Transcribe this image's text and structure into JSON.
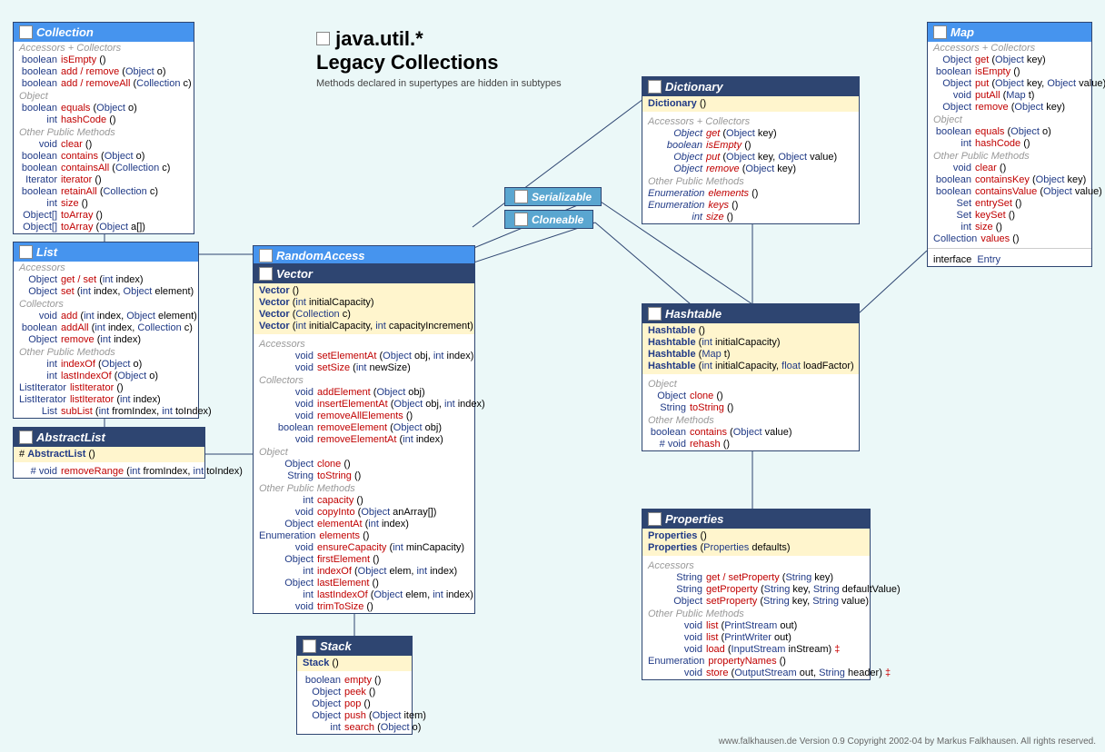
{
  "title1": "java.util.*",
  "title2": "Legacy Collections",
  "subtitle": "Methods declared in supertypes are hidden in subtypes",
  "footer": "www.falkhausen.de Version 0.9 Copyright 2002-04 by Markus Falkhausen. All rights reserved.",
  "ser": "Serializable",
  "clo": "Cloneable",
  "ra": "RandomAccess",
  "collection": {
    "title": "Collection",
    "secs": [
      {
        "h": "Accessors + Collectors",
        "rows": [
          {
            "ret": "boolean",
            "name": "isEmpty",
            "args": "()"
          },
          {
            "ret": "boolean",
            "name": "add / remove",
            "args": "(<t>Object</t> o)"
          },
          {
            "ret": "boolean",
            "name": "add / removeAll",
            "args": "(<t>Collection</t> c)"
          }
        ]
      },
      {
        "h": "Object",
        "rows": [
          {
            "ret": "boolean",
            "name": "equals",
            "args": "(<t>Object</t> o)"
          },
          {
            "ret": "int",
            "name": "hashCode",
            "args": "()"
          }
        ]
      },
      {
        "h": "Other Public Methods",
        "rows": [
          {
            "ret": "void",
            "name": "clear",
            "args": "()"
          },
          {
            "ret": "boolean",
            "name": "contains",
            "args": "(<t>Object</t> o)"
          },
          {
            "ret": "boolean",
            "name": "containsAll",
            "args": "(<t>Collection</t> c)"
          },
          {
            "ret": "Iterator",
            "name": "iterator",
            "args": "()"
          },
          {
            "ret": "boolean",
            "name": "retainAll",
            "args": "(<t>Collection</t> c)"
          },
          {
            "ret": "int",
            "name": "size",
            "args": "()"
          },
          {
            "ret": "Object[]",
            "name": "toArray",
            "args": "()"
          },
          {
            "ret": "Object[]",
            "name": "toArray",
            "args": "(<t>Object</t> a[])"
          }
        ]
      }
    ]
  },
  "list": {
    "title": "List",
    "secs": [
      {
        "h": "Accessors",
        "rows": [
          {
            "ret": "Object",
            "name": "get / set",
            "args": "(<t>int</t> index)"
          },
          {
            "ret": "Object",
            "name": "set",
            "args": "(<t>int</t> index, <t>Object</t> element)"
          }
        ]
      },
      {
        "h": "Collectors",
        "rows": [
          {
            "ret": "void",
            "name": "add",
            "args": "(<t>int</t> index, <t>Object</t> element)"
          },
          {
            "ret": "boolean",
            "name": "addAll",
            "args": "(<t>int</t> index, <t>Collection</t> c)"
          },
          {
            "ret": "Object",
            "name": "remove",
            "args": "(<t>int</t> index)"
          }
        ]
      },
      {
        "h": "Other Public Methods",
        "rows": [
          {
            "ret": "int",
            "name": "indexOf",
            "args": "(<t>Object</t> o)"
          },
          {
            "ret": "int",
            "name": "lastIndexOf",
            "args": "(<t>Object</t> o)"
          },
          {
            "ret": "ListIterator",
            "name": "listIterator",
            "args": "()"
          },
          {
            "ret": "ListIterator",
            "name": "listIterator",
            "args": "(<t>int</t> index)"
          },
          {
            "ret": "List",
            "name": "subList",
            "args": "(<t>int</t> fromIndex, <t>int</t> toIndex)"
          }
        ]
      }
    ]
  },
  "abstractlist": {
    "title": "AbstractList",
    "ctors": [
      "# <b>AbstractList</b> ()"
    ],
    "rows": [
      {
        "ret": "#  void",
        "name": "removeRange",
        "args": "(<t>int</t> fromIndex, <t>int</t> toIndex)"
      }
    ]
  },
  "vector": {
    "title": "Vector",
    "ctors": [
      "<b>Vector</b> ()",
      "<b>Vector</b> (<t>int</t> initialCapacity)",
      "<b>Vector</b> (<t>Collection</t> c)",
      "<b>Vector</b> (<t>int</t> initialCapacity, <t>int</t> capacityIncrement)"
    ],
    "secs": [
      {
        "h": "Accessors",
        "rows": [
          {
            "ret": "void",
            "name": "setElementAt",
            "args": "(<t>Object</t> obj, <t>int</t> index)"
          },
          {
            "ret": "void",
            "name": "setSize",
            "args": "(<t>int</t> newSize)"
          }
        ]
      },
      {
        "h": "Collectors",
        "rows": [
          {
            "ret": "void",
            "name": "addElement",
            "args": "(<t>Object</t> obj)"
          },
          {
            "ret": "void",
            "name": "insertElementAt",
            "args": "(<t>Object</t> obj, <t>int</t> index)"
          },
          {
            "ret": "void",
            "name": "removeAllElements",
            "args": "()"
          },
          {
            "ret": "boolean",
            "name": "removeElement",
            "args": "(<t>Object</t> obj)"
          },
          {
            "ret": "void",
            "name": "removeElementAt",
            "args": "(<t>int</t> index)"
          }
        ]
      },
      {
        "h": "Object",
        "rows": [
          {
            "ret": "Object",
            "name": "clone",
            "args": "()"
          },
          {
            "ret": "String",
            "name": "toString",
            "args": "()"
          }
        ]
      },
      {
        "h": "Other Public Methods",
        "rows": [
          {
            "ret": "int",
            "name": "capacity",
            "args": "()"
          },
          {
            "ret": "void",
            "name": "copyInto",
            "args": "(<t>Object</t> anArray[])"
          },
          {
            "ret": "Object",
            "name": "elementAt",
            "args": "(<t>int</t> index)"
          },
          {
            "ret": "Enumeration",
            "name": "elements",
            "args": "()"
          },
          {
            "ret": "void",
            "name": "ensureCapacity",
            "args": "(<t>int</t> minCapacity)"
          },
          {
            "ret": "Object",
            "name": "firstElement",
            "args": "()"
          },
          {
            "ret": "int",
            "name": "indexOf",
            "args": "(<t>Object</t> elem, <t>int</t> index)"
          },
          {
            "ret": "Object",
            "name": "lastElement",
            "args": "()"
          },
          {
            "ret": "int",
            "name": "lastIndexOf",
            "args": "(<t>Object</t> elem, <t>int</t> index)"
          },
          {
            "ret": "void",
            "name": "trimToSize",
            "args": "()"
          }
        ]
      }
    ]
  },
  "stack": {
    "title": "Stack",
    "ctors": [
      "<b>Stack</b> ()"
    ],
    "rows": [
      {
        "ret": "boolean",
        "name": "empty",
        "args": "()"
      },
      {
        "ret": "Object",
        "name": "peek",
        "args": "()"
      },
      {
        "ret": "Object",
        "name": "pop",
        "args": "()"
      },
      {
        "ret": "Object",
        "name": "push",
        "args": "(<t>Object</t> item)"
      },
      {
        "ret": "int",
        "name": "search",
        "args": "(<t>Object</t> o)"
      }
    ]
  },
  "dictionary": {
    "title": "Dictionary",
    "ctors": [
      "<b>Dictionary</b> ()"
    ],
    "secs": [
      {
        "h": "Accessors + Collectors",
        "rows": [
          {
            "ret": "Object",
            "name": "get",
            "args": "(<t>Object</t> key)",
            "i": true
          },
          {
            "ret": "boolean",
            "name": "isEmpty",
            "args": "()",
            "i": true
          },
          {
            "ret": "Object",
            "name": "put",
            "args": "(<t>Object</t> key, <t>Object</t> value)",
            "i": true
          },
          {
            "ret": "Object",
            "name": "remove",
            "args": "(<t>Object</t> key)",
            "i": true
          }
        ]
      },
      {
        "h": "Other Public Methods",
        "rows": [
          {
            "ret": "Enumeration",
            "name": "elements",
            "args": "()",
            "i": true
          },
          {
            "ret": "Enumeration",
            "name": "keys",
            "args": "()",
            "i": true
          },
          {
            "ret": "int",
            "name": "size",
            "args": "()",
            "i": true
          }
        ]
      }
    ]
  },
  "map": {
    "title": "Map",
    "secs": [
      {
        "h": "Accessors + Collectors",
        "rows": [
          {
            "ret": "Object",
            "name": "get",
            "args": "(<t>Object</t> key)"
          },
          {
            "ret": "boolean",
            "name": "isEmpty",
            "args": "()"
          },
          {
            "ret": "Object",
            "name": "put",
            "args": "(<t>Object</t> key, <t>Object</t> value)"
          },
          {
            "ret": "void",
            "name": "putAll",
            "args": "(<t>Map</t> t)"
          },
          {
            "ret": "Object",
            "name": "remove",
            "args": "(<t>Object</t> key)"
          }
        ]
      },
      {
        "h": "Object",
        "rows": [
          {
            "ret": "boolean",
            "name": "equals",
            "args": "(<t>Object</t> o)"
          },
          {
            "ret": "int",
            "name": "hashCode",
            "args": "()"
          }
        ]
      },
      {
        "h": "Other Public Methods",
        "rows": [
          {
            "ret": "void",
            "name": "clear",
            "args": "()"
          },
          {
            "ret": "boolean",
            "name": "containsKey",
            "args": "(<t>Object</t> key)"
          },
          {
            "ret": "boolean",
            "name": "containsValue",
            "args": "(<t>Object</t> value)"
          },
          {
            "ret": "Set",
            "name": "entrySet",
            "args": "()"
          },
          {
            "ret": "Set",
            "name": "keySet",
            "args": "()"
          },
          {
            "ret": "int",
            "name": "size",
            "args": "()"
          },
          {
            "ret": "Collection",
            "name": "values",
            "args": "()"
          }
        ]
      }
    ],
    "tail": "interface &nbsp;<span class='t'>Entry</span>"
  },
  "hashtable": {
    "title": "Hashtable",
    "ctors": [
      "<b>Hashtable</b> ()",
      "<b>Hashtable</b> (<t>int</t> initialCapacity)",
      "<b>Hashtable</b> (<t>Map</t> t)",
      "<b>Hashtable</b> (<t>int</t> initialCapacity, <t>float</t> loadFactor)"
    ],
    "secs": [
      {
        "h": "Object",
        "rows": [
          {
            "ret": "Object",
            "name": "clone",
            "args": "()"
          },
          {
            "ret": "String",
            "name": "toString",
            "args": "()"
          }
        ]
      },
      {
        "h": "Other Methods",
        "rows": [
          {
            "ret": "boolean",
            "name": "contains",
            "args": "(<t>Object</t> value)"
          },
          {
            "ret": "#   void",
            "name": "rehash",
            "args": "()"
          }
        ]
      }
    ]
  },
  "properties": {
    "title": "Properties",
    "ctors": [
      "<b>Properties</b> ()",
      "<b>Properties</b> (<t>Properties</t> defaults)"
    ],
    "secs": [
      {
        "h": "Accessors",
        "rows": [
          {
            "ret": "String",
            "name": "get / setProperty",
            "args": "(<t>String</t> key)"
          },
          {
            "ret": "String",
            "name": "getProperty",
            "args": "(<t>String</t> key, <t>String</t> defaultValue)"
          },
          {
            "ret": "Object",
            "name": "setProperty",
            "args": "(<t>String</t> key, <t>String</t> value)"
          }
        ]
      },
      {
        "h": "Other Public Methods",
        "rows": [
          {
            "ret": "void",
            "name": "list",
            "args": "(<t>PrintStream</t> out)"
          },
          {
            "ret": "void",
            "name": "list",
            "args": "(<t>PrintWriter</t> out)"
          },
          {
            "ret": "void",
            "name": "load",
            "args": "(<t>InputStream</t> inStream) <span style='color:#c00'>‡</span>"
          },
          {
            "ret": "Enumeration",
            "name": "propertyNames",
            "args": "()"
          },
          {
            "ret": "void",
            "name": "store",
            "args": "(<t>OutputStream</t> out, <t>String</t> header) <span style='color:#c00'>‡</span>"
          }
        ]
      }
    ]
  }
}
